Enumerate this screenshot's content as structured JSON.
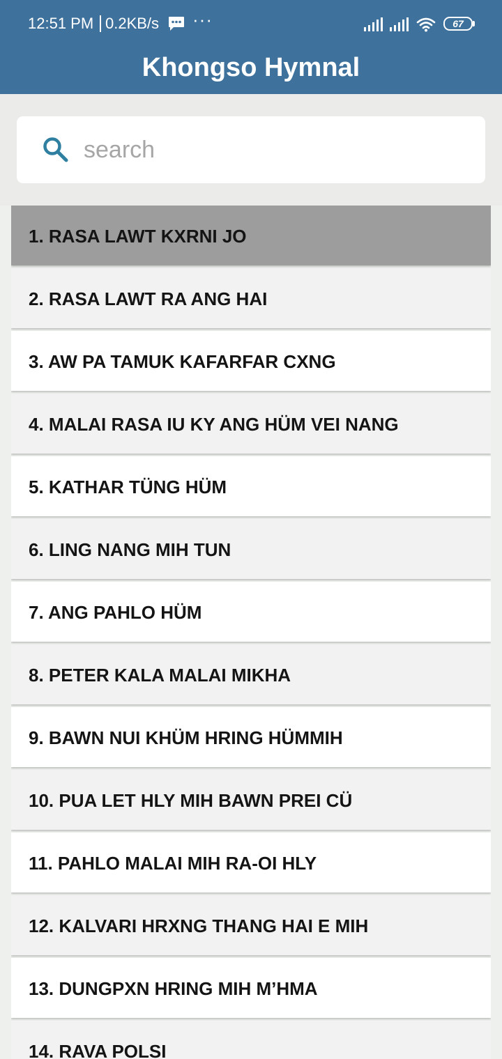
{
  "status_bar": {
    "time": "12:51 PM",
    "network_speed": "0.2KB/s",
    "more": "···",
    "battery": "67",
    "icons": [
      "message-icon",
      "signal-icon",
      "signal-icon",
      "wifi-icon",
      "battery-icon"
    ]
  },
  "app_bar": {
    "title": "Khongso Hymnal",
    "color": "#3e719c"
  },
  "search": {
    "placeholder": "search",
    "value": "",
    "icon": "search-icon",
    "icon_color": "#2f7fa0"
  },
  "hymns": [
    {
      "label": "1. RASA LAWT KXRNI JO"
    },
    {
      "label": "2. RASA LAWT RA ANG HAI"
    },
    {
      "label": "3. AW PA TAMUK KAFARFAR CXNG"
    },
    {
      "label": "4. MALAI RASA IU KY ANG HÜM VEI NANG"
    },
    {
      "label": "5. KATHAR TÜNG HÜM"
    },
    {
      "label": "6. LING NANG MIH TUN"
    },
    {
      "label": "7. ANG PAHLO HÜM"
    },
    {
      "label": "8. PETER KALA MALAI MIKHA"
    },
    {
      "label": "9. BAWN NUI KHÜM HRING HÜMMIH"
    },
    {
      "label": "10. PUA LET HLY MIH BAWN PREI CÜ"
    },
    {
      "label": "11. PAHLO MALAI MIH RA-OI HLY"
    },
    {
      "label": "12. KALVARI HRXNG THANG HAI E MIH"
    },
    {
      "label": "13. DUNGPXN HRING MIH M’HMA"
    },
    {
      "label": "14. RAVA POLSI"
    }
  ]
}
